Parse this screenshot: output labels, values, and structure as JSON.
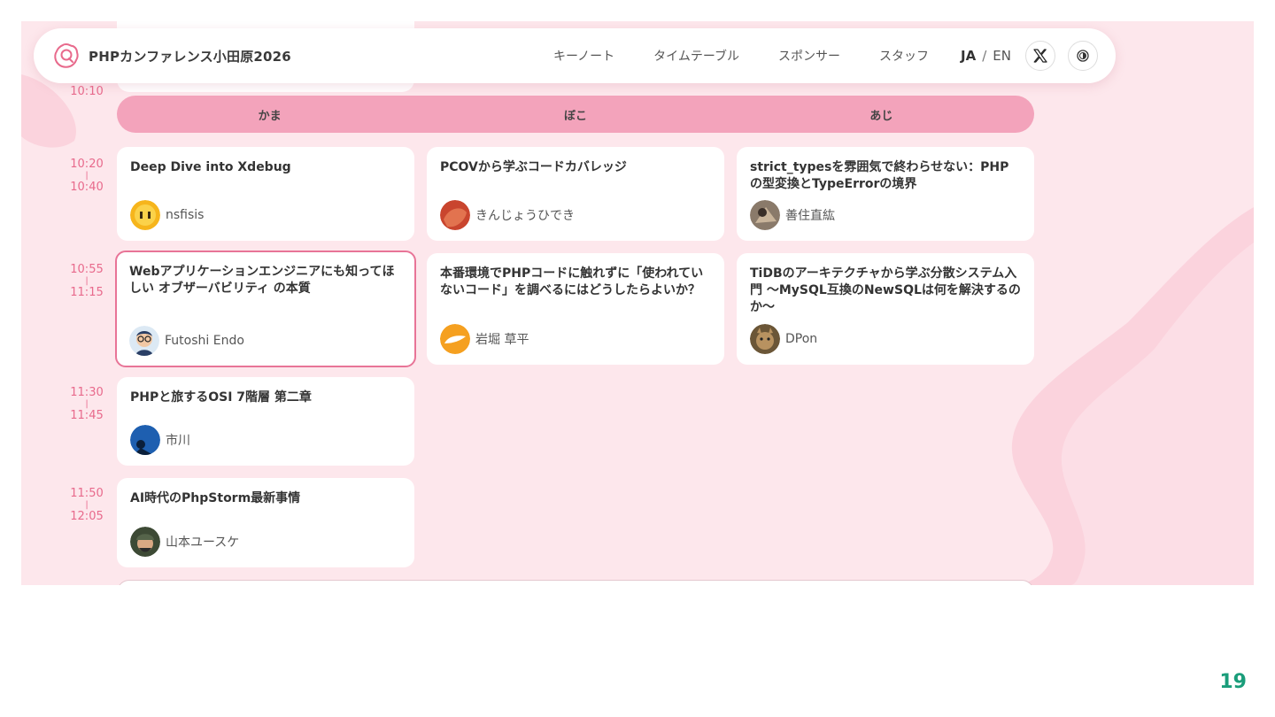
{
  "header": {
    "brand": "PHPカンファレンス小田原2026",
    "nav": [
      "キーノート",
      "タイムテーブル",
      "スポンサー",
      "スタッフ"
    ],
    "lang_active": "JA",
    "lang_sep": "/",
    "lang_other": "EN"
  },
  "timeline": {
    "prev_end": "10:10",
    "slots": [
      {
        "start": "10:20",
        "end": "10:40"
      },
      {
        "start": "10:55",
        "end": "11:15"
      },
      {
        "start": "11:30",
        "end": "11:45"
      },
      {
        "start": "11:50",
        "end": "12:05"
      }
    ],
    "separator": "|"
  },
  "rooms": [
    "かま",
    "ぼこ",
    "あじ"
  ],
  "sessions": [
    {
      "title": "Deep Dive into Xdebug",
      "speaker": "nsfisis"
    },
    {
      "title": "PCOVから学ぶコードカバレッジ",
      "speaker": "きんじょうひでき"
    },
    {
      "title": "strict_typesを雰囲気で終わらせない：PHPの型変換とTypeErrorの境界",
      "speaker": "善住直紘"
    },
    {
      "title": "Webアプリケーションエンジニアにも知ってほしい オブザーバビリティ の本質",
      "speaker": "Futoshi Endo"
    },
    {
      "title": "本番環境でPHPコードに触れずに「使われていないコード」を調べるにはどうしたらよいか？",
      "speaker": "岩堀 草平"
    },
    {
      "title": "TiDBのアーキテクチャから学ぶ分散システム入門 〜MySQL互換のNewSQLは何を解決するのか〜",
      "speaker": "DPon"
    },
    {
      "title": "PHPと旅するOSI 7階層 第二章",
      "speaker": "市川"
    },
    {
      "title": "AI時代のPhpStorm最新事情",
      "speaker": "山本ユースケ"
    }
  ],
  "page_number": "19",
  "colors": {
    "background": "#fde7ec",
    "blob": "#fbd3dd",
    "room_bar": "#f3a3bb",
    "time_text": "#e86a8c",
    "selected_border": "#e87497",
    "page_number": "#1a9d7a"
  },
  "icons": [
    "conference-logo-icon",
    "x-logo-icon",
    "contrast-toggle-icon"
  ]
}
